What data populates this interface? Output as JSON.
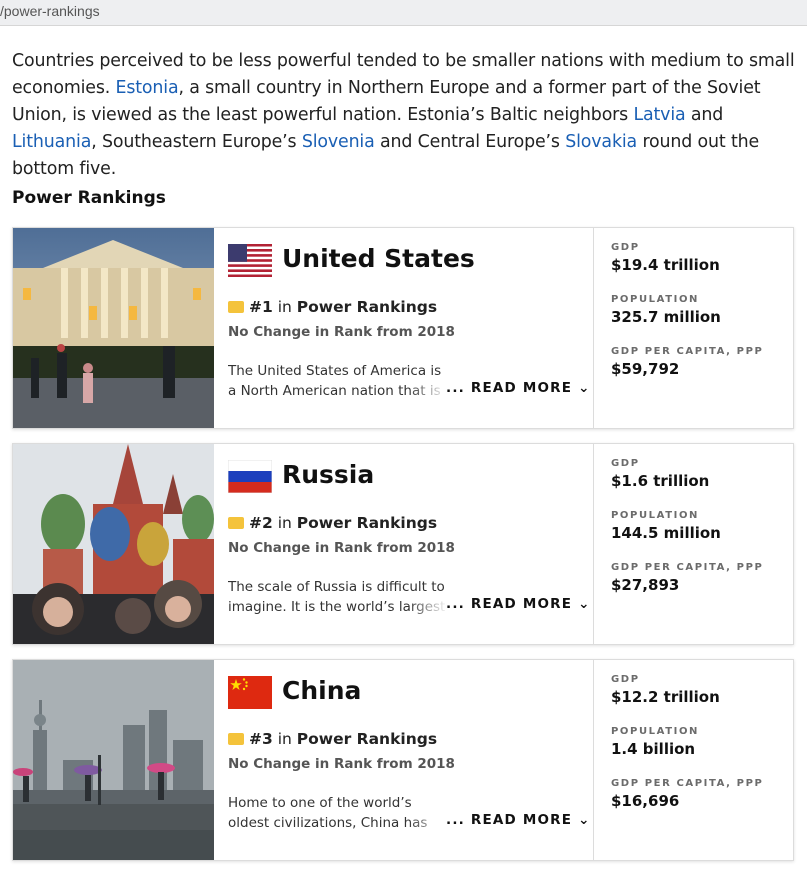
{
  "urlbar": {
    "text": "/power-rankings"
  },
  "intro": {
    "p1": "Countries perceived to be less powerful tended to be smaller nations with medium to small economies. ",
    "link_estonia": "Estonia",
    "p2": ", a small country in Northern Europe and a former part of the Soviet Union, is viewed as the least powerful nation. Estonia’s Baltic neighbors ",
    "link_latvia": "Latvia",
    "p3": " and ",
    "link_lithuania": "Lithuania",
    "p4": ", Southeastern Europe’s ",
    "link_slovenia": "Slovenia",
    "p5": " and Central Europe’s ",
    "link_slovakia": "Slovakia",
    "p6": " round out the bottom five."
  },
  "section_title": "Power Rankings",
  "cards": [
    {
      "country": "United States",
      "rank": "#1",
      "rank_in": " in ",
      "rank_list": "Power Rankings",
      "change": "No Change in Rank from 2018",
      "desc": "The United States of America is a North American nation that is the world’s most dominant",
      "read_more": "... READ MORE ⌄",
      "stats": [
        {
          "label": "GDP",
          "value": "$19.4 trillion"
        },
        {
          "label": "POPULATION",
          "value": "325.7 million"
        },
        {
          "label": "GDP PER CAPITA, PPP",
          "value": "$59,792"
        }
      ]
    },
    {
      "country": "Russia",
      "rank": "#2",
      "rank_in": " in ",
      "rank_list": "Power Rankings",
      "change": "No Change in Rank from 2018",
      "desc": "The scale of Russia is difficult to imagine. It is the world’s largest country by land mass",
      "read_more": "... READ MORE ⌄",
      "stats": [
        {
          "label": "GDP",
          "value": "$1.6 trillion"
        },
        {
          "label": "POPULATION",
          "value": "144.5 million"
        },
        {
          "label": "GDP PER CAPITA, PPP",
          "value": "$27,893"
        }
      ]
    },
    {
      "country": "China",
      "rank": "#3",
      "rank_in": " in ",
      "rank_list": "Power Rankings",
      "change": "No Change in Rank from 2018",
      "desc": "Home to one of the world’s oldest civilizations, China has been ruled by the Communist Party",
      "read_more": "... READ MORE ⌄",
      "stats": [
        {
          "label": "GDP",
          "value": "$12.2 trillion"
        },
        {
          "label": "POPULATION",
          "value": "1.4 billion"
        },
        {
          "label": "GDP PER CAPITA, PPP",
          "value": "$16,696"
        }
      ]
    }
  ],
  "colors": {
    "link": "#1a5fb4",
    "ribbon": "#f4c33b"
  }
}
